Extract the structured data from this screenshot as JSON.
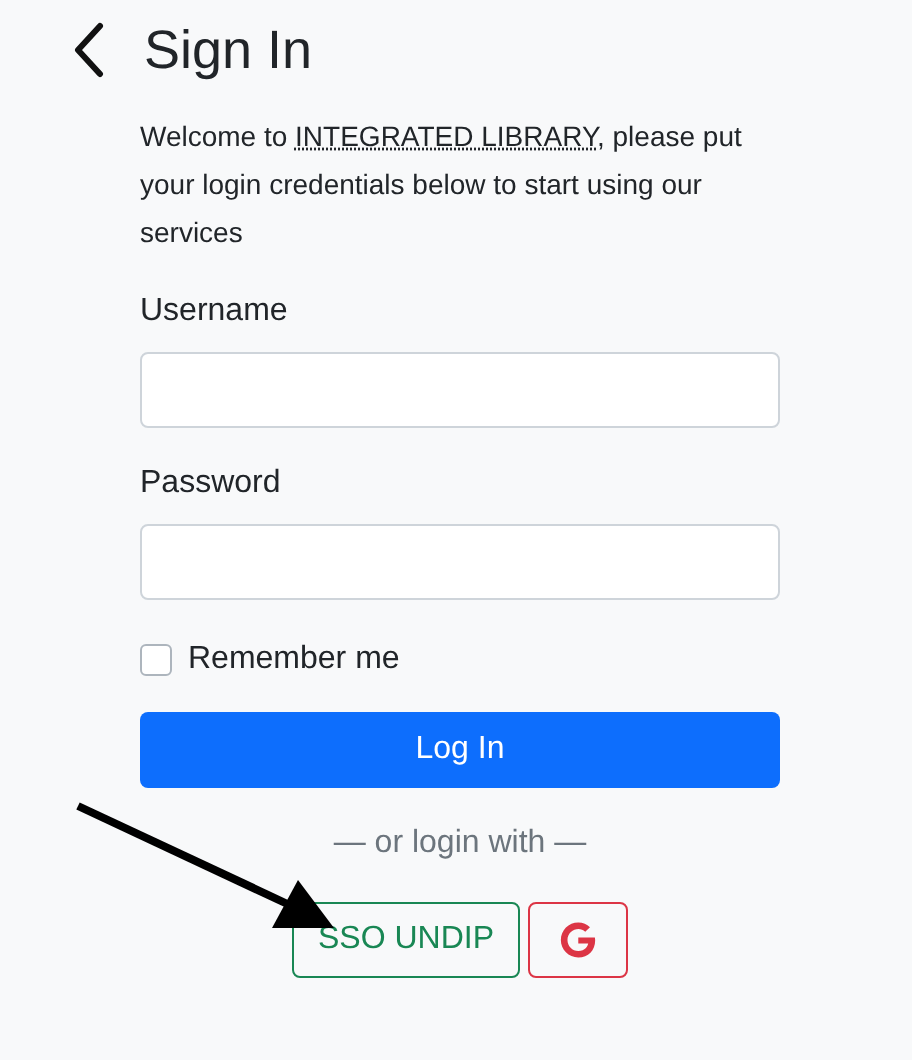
{
  "header": {
    "title": "Sign In"
  },
  "intro": {
    "before": "Welcome to ",
    "abbr": "INTEGRATED LIBRARY",
    "after": ", please put your login credentials below to start using our services"
  },
  "fields": [
    {
      "label": "Username"
    },
    {
      "label": "Password"
    }
  ],
  "remember": {
    "label": "Remember me",
    "checked": false
  },
  "login_button": "Log In",
  "divider_text": "— or login with —",
  "alt_logins": [
    {
      "kind": "text",
      "label": "SSO UNDIP"
    },
    {
      "kind": "google"
    }
  ]
}
